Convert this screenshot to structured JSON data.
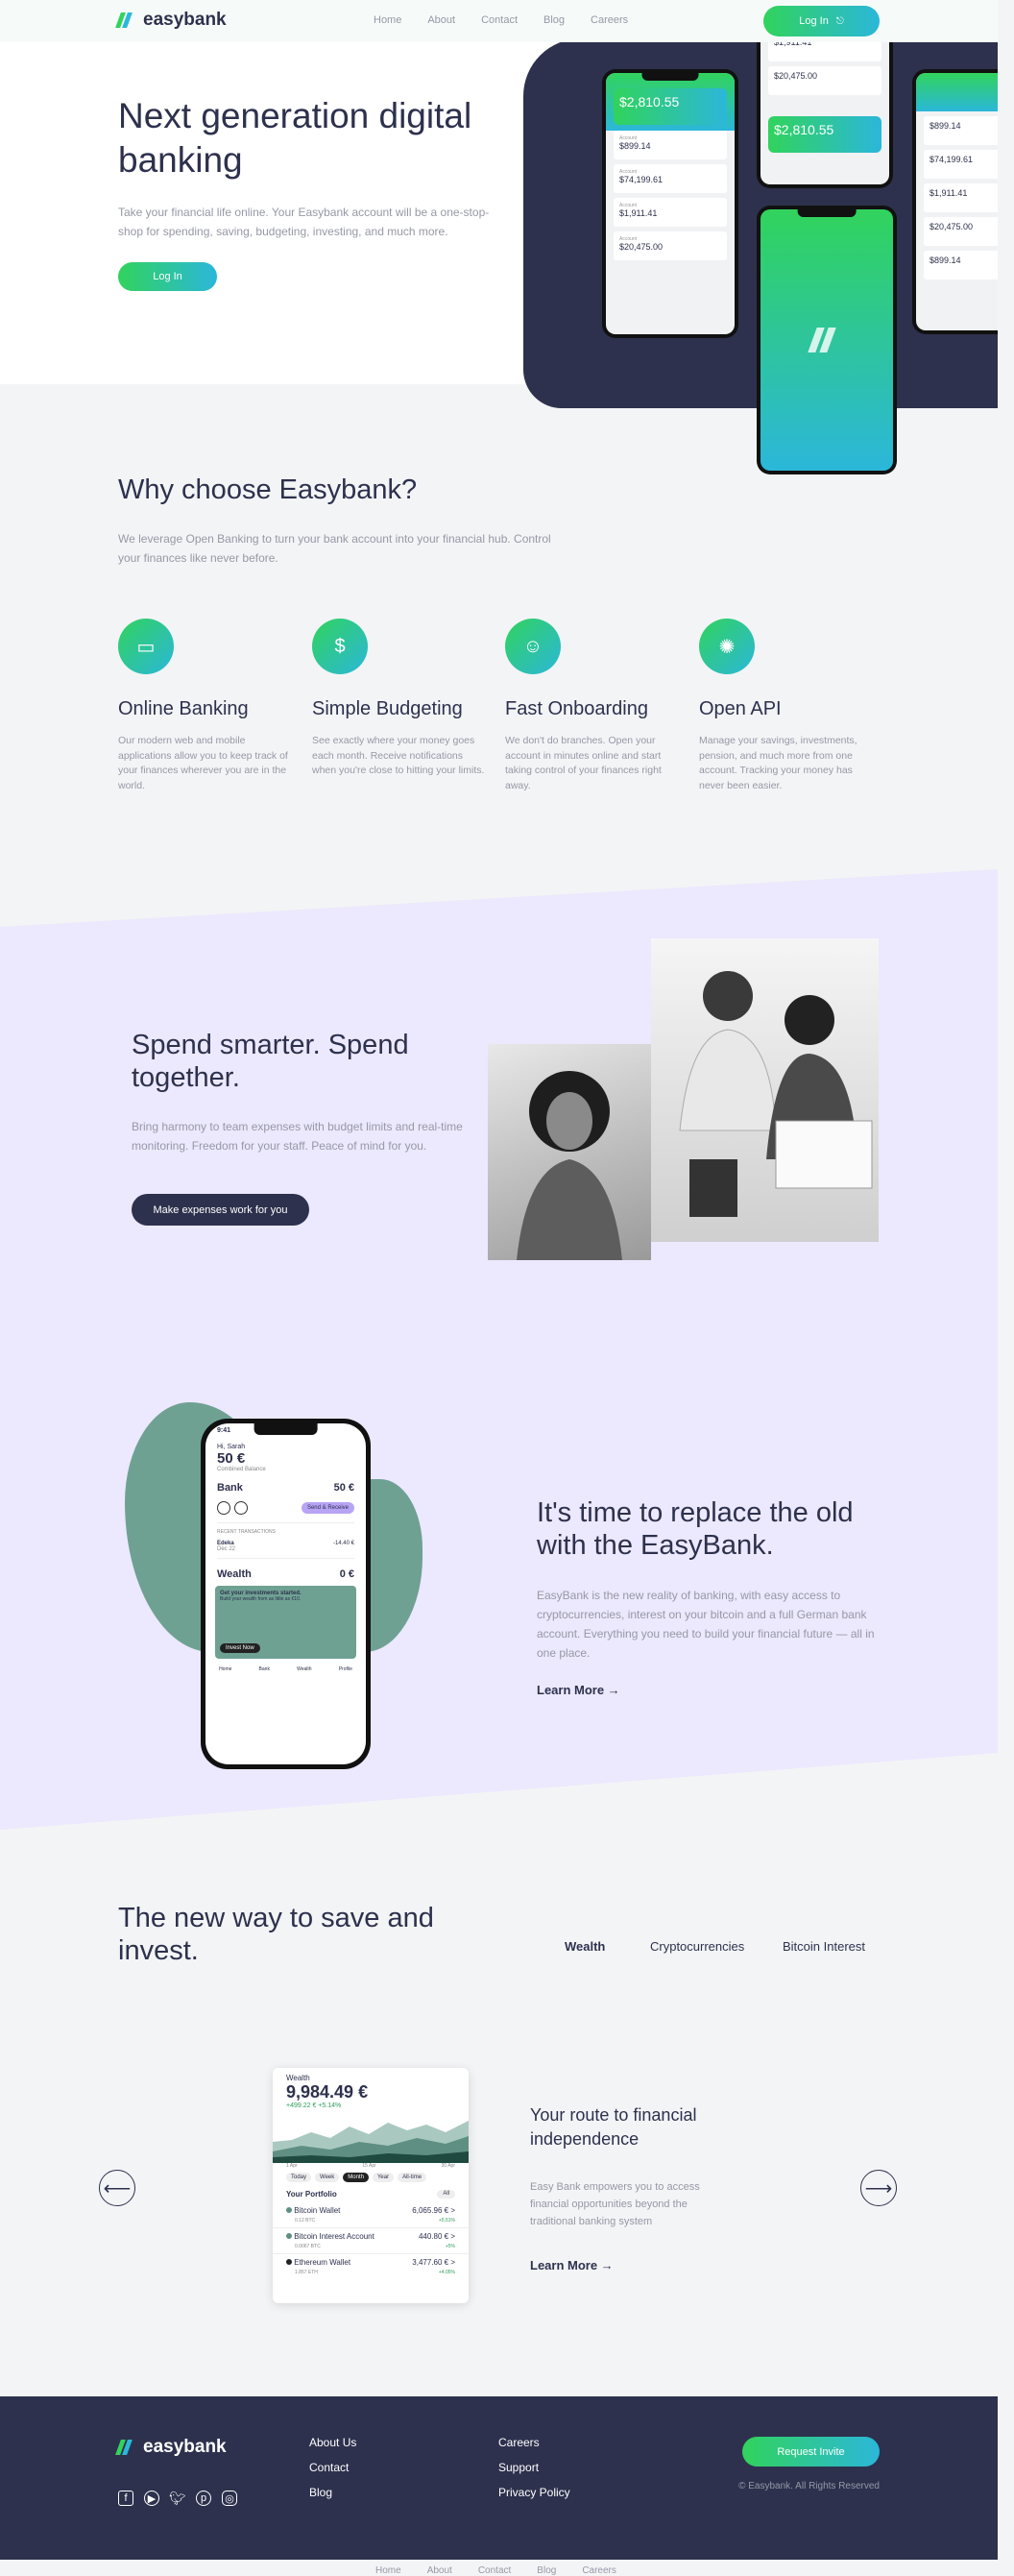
{
  "nav": {
    "logo": "easybank",
    "links": [
      "Home",
      "About",
      "Contact",
      "Blog",
      "Careers"
    ],
    "login": "Log In"
  },
  "hero": {
    "title": "Next generation digital banking",
    "text": "Take your financial life online. Your Easybank account will be a one-stop-shop for spending, saving, budgeting, investing, and much more.",
    "cta": "Log In",
    "phone": {
      "total": "$2,810.55",
      "rows": [
        "$899.14",
        "$74,199.61",
        "$1,911.41",
        "$20,475.00"
      ]
    }
  },
  "why": {
    "title": "Why choose Easybank?",
    "text": "We leverage Open Banking to turn your bank account into your financial hub. Control your finances like never before.",
    "features": [
      {
        "title": "Online Banking",
        "text": "Our modern web and mobile applications allow you to keep track of your finances wherever you are in the world.",
        "icon": "online-banking-icon"
      },
      {
        "title": "Simple Budgeting",
        "text": "See exactly where your money goes each month. Receive notifications when you're close to hitting your limits.",
        "icon": "budgeting-icon"
      },
      {
        "title": "Fast Onboarding",
        "text": "We don't do branches. Open your account in minutes online and start taking control of your finances right away.",
        "icon": "onboarding-icon"
      },
      {
        "title": "Open API",
        "text": "Manage your savings, investments, pension, and much more from one account. Tracking your money has never been easier.",
        "icon": "api-icon"
      }
    ]
  },
  "spend": {
    "title": "Spend smarter. Spend together.",
    "text": "Bring harmony to team expenses with budget limits and real-time monitoring. Freedom for your staff. Peace of mind for you.",
    "cta": "Make expenses work for you"
  },
  "replace": {
    "title": "It's time to replace the old with the EasyBank.",
    "text": "EasyBank is the new reality of banking, with easy access to cryptocurrencies, interest on your bitcoin and a full German bank account. Everything you need to build your financial future — all in one place.",
    "learn": "Learn More →",
    "phone": {
      "time": "9:41",
      "greeting": "Hi, Sarah",
      "balance": "50 €",
      "balance_label": "Combined Balance",
      "bank": "Bank",
      "bank_amount": "50 €",
      "send": "Send & Receive",
      "recent": "RECENT TRANSACTIONS",
      "txn_name": "Edeka",
      "txn_date": "Dec 22",
      "txn_amount": "-14.40 €",
      "wealth": "Wealth",
      "wealth_amount": "0 €",
      "invest_title": "Get your investments started.",
      "invest_text": "Build your wealth from as little as €10.",
      "invest_btn": "Invest Now",
      "tabs": [
        "Home",
        "Bank",
        "Wealth",
        "Profile"
      ]
    }
  },
  "invest": {
    "title": "The new way to save and invest.",
    "tabs": [
      "Wealth",
      "Cryptocurrencies",
      "Bitcoin Interest"
    ],
    "card": {
      "label": "Wealth",
      "amount": "9,984.49 €",
      "change": "+499.22 € +5.14%",
      "dates": [
        "1 Apr",
        "15 Apr",
        "30 Apr"
      ],
      "ranges": [
        "Today",
        "Week",
        "Month",
        "Year",
        "All-time"
      ],
      "portfolio": "Your Portfolio",
      "filter": "All",
      "rows": [
        {
          "name": "Bitcoin Wallet",
          "sub": "0.12 BTC",
          "value": "6,065.96 € >",
          "pct": "+5.51%"
        },
        {
          "name": "Bitcoin Interest Account",
          "sub": "0.0067 BTC",
          "value": "440.80 € >",
          "pct": "+5%"
        },
        {
          "name": "Ethereum Wallet",
          "sub": "1.857 ETH",
          "value": "3,477.60 € >",
          "pct": "+4.05%"
        }
      ]
    },
    "route_title": "Your route to financial independence",
    "route_text": "Easy Bank empowers you to access financial opportunities beyond the traditional banking system",
    "learn": "Learn More →"
  },
  "footer": {
    "logo": "easybank",
    "col1": [
      "About Us",
      "Contact",
      "Blog"
    ],
    "col2": [
      "Careers",
      "Support",
      "Privacy Policy"
    ],
    "cta": "Request Invite",
    "copyright": "© Easybank. All Rights Reserved",
    "socials": [
      "facebook-icon",
      "youtube-icon",
      "twitter-icon",
      "pinterest-icon",
      "instagram-icon"
    ]
  },
  "bottom_nav": [
    "Home",
    "About",
    "Contact",
    "Blog",
    "Careers"
  ],
  "colors": {
    "navy": "#2d314d",
    "green": "#31d35c",
    "cyan": "#2bb7da",
    "purple_bg": "#ece8fd",
    "teal_blob": "#6fa193"
  }
}
